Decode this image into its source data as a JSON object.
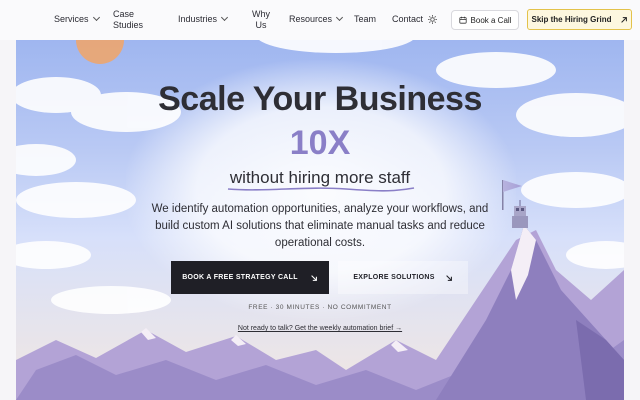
{
  "nav": {
    "items": [
      {
        "label": "Services",
        "dropdown": true
      },
      {
        "label": "Case Studies",
        "dropdown": false
      },
      {
        "label": "Industries",
        "dropdown": true
      },
      {
        "label": "Why Us",
        "dropdown": false
      },
      {
        "label": "Resources",
        "dropdown": true
      },
      {
        "label": "Team",
        "dropdown": false
      },
      {
        "label": "Contact",
        "dropdown": false
      }
    ],
    "theme_icon": "sun-icon",
    "book_call_label": "Book a Call",
    "book_call_icon": "calendar-icon",
    "cta_label": "Skip the Hiring Grind",
    "cta_icon": "arrow-up-right-icon"
  },
  "hero": {
    "headline": "Scale Your Business",
    "multiplier": "10X",
    "subhead": "without hiring more staff",
    "description": "We identify automation opportunities, analyze your workflows, and build custom AI solutions that eliminate manual tasks and reduce operational costs.",
    "primary_button": "BOOK A FREE STRATEGY CALL",
    "secondary_button": "EXPLORE SOLUTIONS",
    "fineprint": "FREE · 30 MINUTES · NO COMMITMENT",
    "brief_link": "Not ready to talk? Get the weekly automation brief →"
  },
  "colors": {
    "accent_purple": "#8a7fc7",
    "dark": "#1f1f26",
    "cta_border": "#e3c24a"
  }
}
